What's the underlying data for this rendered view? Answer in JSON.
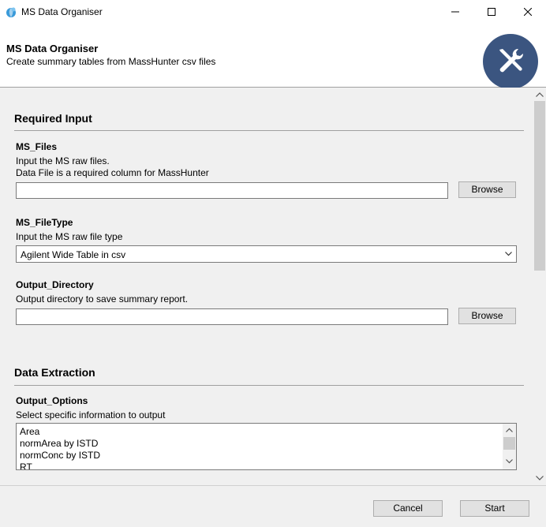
{
  "window": {
    "title": "MS Data Organiser"
  },
  "header": {
    "title": "MS Data Organiser",
    "subtitle": "Create summary tables from MassHunter csv files",
    "logo_icon": "tools-icon",
    "logo_color": "#3b5580"
  },
  "sections": {
    "required_input": {
      "title": "Required Input"
    },
    "data_extraction": {
      "title": "Data Extraction"
    }
  },
  "fields": {
    "ms_files": {
      "label": "MS_Files",
      "help_line1": "Input the MS raw files.",
      "help_line2": "Data File is a required column for MassHunter",
      "value": "",
      "browse_label": "Browse"
    },
    "ms_filetype": {
      "label": "MS_FileType",
      "help": "Input the MS raw file type",
      "selected": "Agilent Wide Table in csv"
    },
    "output_directory": {
      "label": "Output_Directory",
      "help": "Output directory to save summary report.",
      "value": "",
      "browse_label": "Browse"
    },
    "output_options": {
      "label": "Output_Options",
      "help": "Select specific information to output",
      "items": [
        "Area",
        "normArea by ISTD",
        "normConc by ISTD",
        "RT"
      ]
    }
  },
  "footer": {
    "cancel_label": "Cancel",
    "start_label": "Start"
  }
}
